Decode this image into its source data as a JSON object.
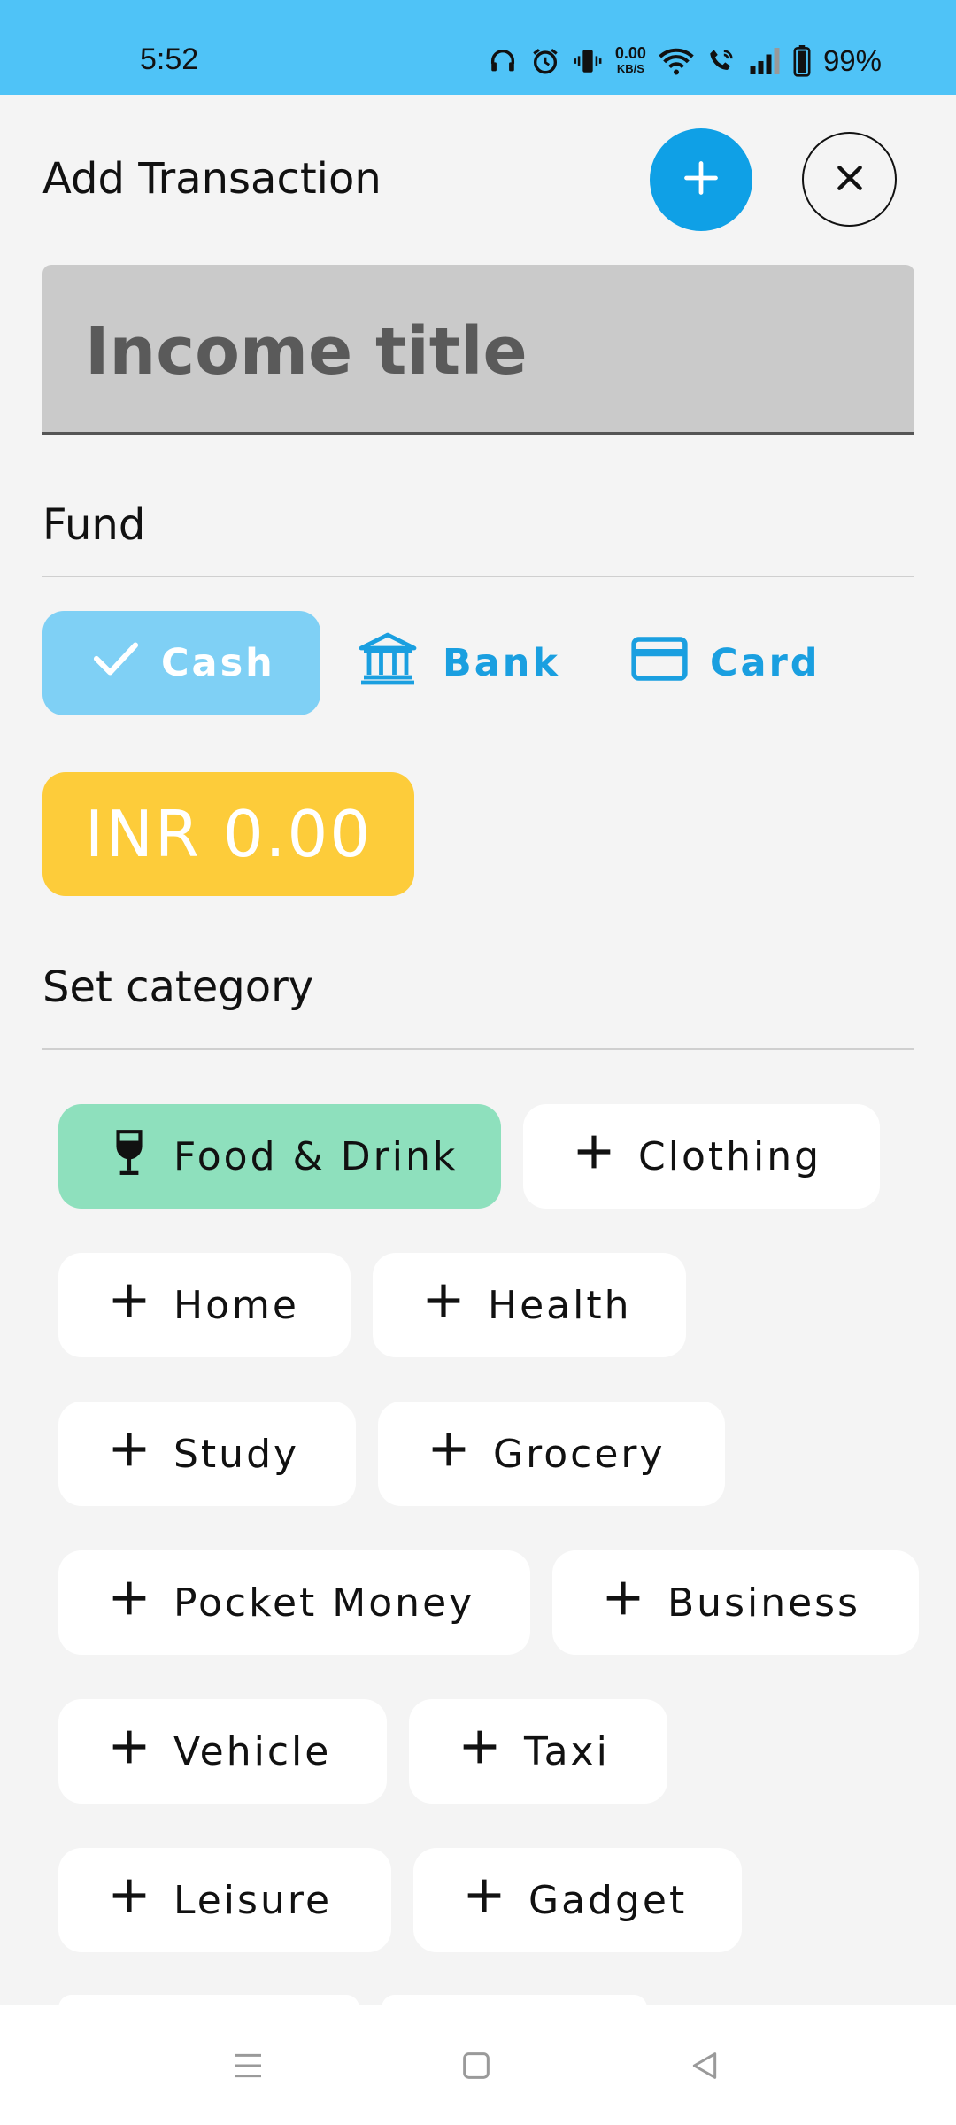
{
  "status": {
    "time": "5:52",
    "net_speed_value": "0.00",
    "net_speed_unit": "KB/S",
    "battery": "99%",
    "icons": [
      "headphones-icon",
      "alarm-icon",
      "vibrate-icon",
      "wifi-icon",
      "wifi-call-icon",
      "signal-icon",
      "battery-icon"
    ]
  },
  "header": {
    "title": "Add Transaction",
    "add_icon": "plus-icon",
    "close_icon": "close-icon"
  },
  "title_field": {
    "placeholder": "Income title",
    "value": ""
  },
  "fund": {
    "label": "Fund",
    "options": [
      {
        "label": "Cash",
        "icon": "check-icon",
        "selected": true
      },
      {
        "label": "Bank",
        "icon": "bank-icon",
        "selected": false
      },
      {
        "label": "Card",
        "icon": "credit-card-icon",
        "selected": false
      }
    ]
  },
  "amount": {
    "label": "INR 0.00"
  },
  "category": {
    "label": "Set category",
    "items": [
      {
        "label": "Food & Drink",
        "icon": "wine-glass-icon",
        "selected": true
      },
      {
        "label": "Clothing",
        "icon": "plus-icon",
        "selected": false
      },
      {
        "label": "Home",
        "icon": "plus-icon",
        "selected": false
      },
      {
        "label": "Health",
        "icon": "plus-icon",
        "selected": false
      },
      {
        "label": "Study",
        "icon": "plus-icon",
        "selected": false
      },
      {
        "label": "Grocery",
        "icon": "plus-icon",
        "selected": false
      },
      {
        "label": "Pocket Money",
        "icon": "plus-icon",
        "selected": false
      },
      {
        "label": "Business",
        "icon": "plus-icon",
        "selected": false
      },
      {
        "label": "Vehicle",
        "icon": "plus-icon",
        "selected": false
      },
      {
        "label": "Taxi",
        "icon": "plus-icon",
        "selected": false
      },
      {
        "label": "Leisure",
        "icon": "plus-icon",
        "selected": false
      },
      {
        "label": "Gadget",
        "icon": "plus-icon",
        "selected": false
      }
    ]
  },
  "colors": {
    "status_bar": "#4fc3f7",
    "accent_blue": "#0fa0e6",
    "selected_fund": "#7fd0f5",
    "amount": "#fdcc3a",
    "selected_category": "#8ee0bd"
  },
  "nav": {
    "icons": [
      "menu-icon",
      "home-square-icon",
      "back-triangle-icon"
    ]
  }
}
